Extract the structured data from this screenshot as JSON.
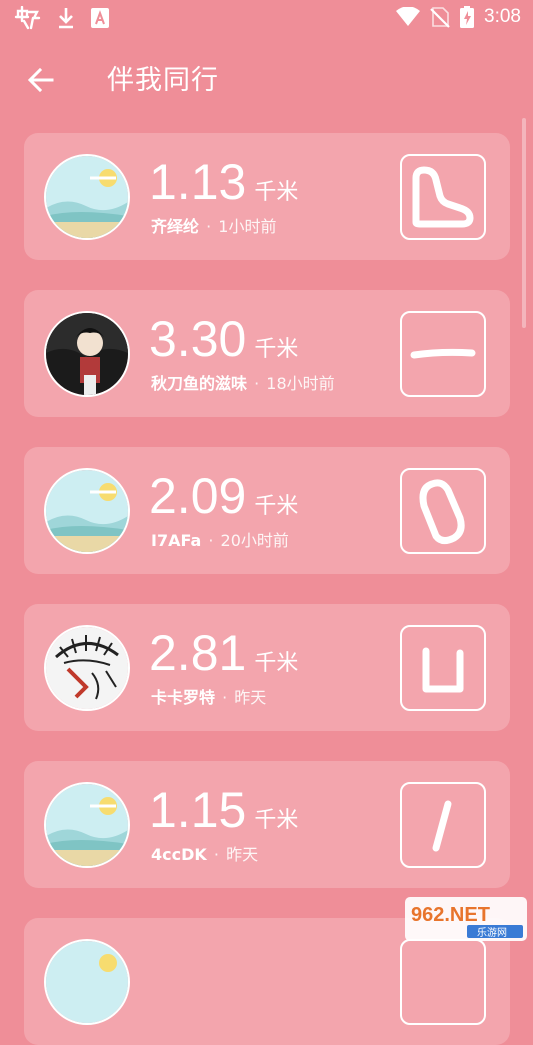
{
  "status_bar": {
    "time": "3:08",
    "left_icons": [
      "app-notification-icon",
      "download-icon",
      "font-app-icon"
    ],
    "right_icons": [
      "wifi-icon",
      "no-sim-icon",
      "battery-charging-icon"
    ]
  },
  "header": {
    "title": "伴我同行",
    "back_icon": "arrow-left-icon"
  },
  "list": {
    "items": [
      {
        "distance": "1.13",
        "unit": "千米",
        "name": "齐绎纶",
        "separator": "·",
        "time": "1小时前",
        "avatar": "landscape-avatar",
        "shape": "boot-shape"
      },
      {
        "distance": "3.30",
        "unit": "千米",
        "name": "秋刀鱼的滋味",
        "separator": "·",
        "time": "18小时前",
        "avatar": "anime-character-avatar",
        "shape": "line-shape"
      },
      {
        "distance": "2.09",
        "unit": "千米",
        "name": "I7AFa",
        "separator": "·",
        "time": "20小时前",
        "avatar": "landscape-avatar",
        "shape": "ring-shape"
      },
      {
        "distance": "2.81",
        "unit": "千米",
        "name": "卡卡罗特",
        "separator": "·",
        "time": "昨天",
        "avatar": "sketch-face-avatar",
        "shape": "u-shape"
      },
      {
        "distance": "1.15",
        "unit": "千米",
        "name": "4ccDK",
        "separator": "·",
        "time": "昨天",
        "avatar": "landscape-avatar",
        "shape": "slash-shape"
      }
    ]
  },
  "watermark": {
    "brand": "962.NET",
    "subtitle": "乐游网"
  },
  "colors": {
    "background": "#ef8e98",
    "card": "#f3a5ad",
    "text": "#ffffff"
  }
}
